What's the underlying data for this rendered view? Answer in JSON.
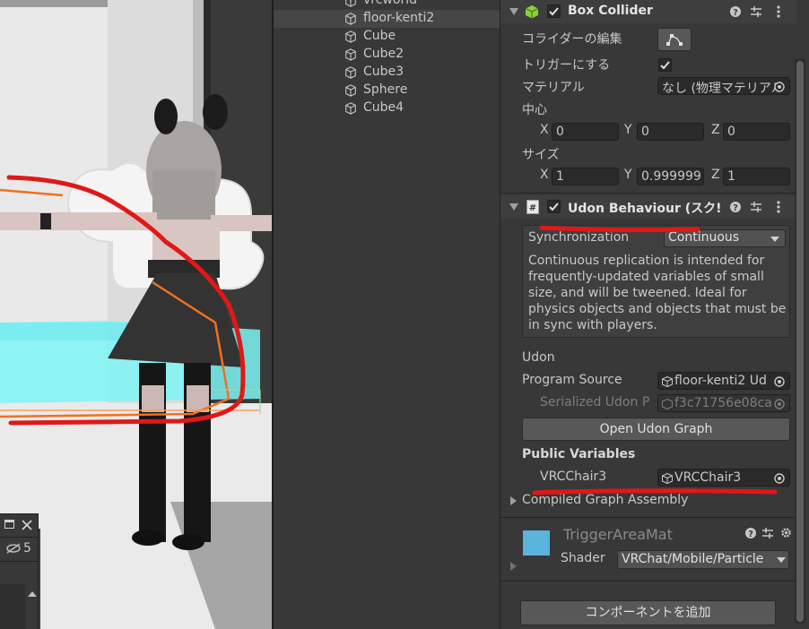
{
  "hierarchy": {
    "items": [
      {
        "label": "vrcworld"
      },
      {
        "label": "floor-kenti2"
      },
      {
        "label": "Cube"
      },
      {
        "label": "Cube2"
      },
      {
        "label": "Cube3"
      },
      {
        "label": "Sphere"
      },
      {
        "label": "Cube4"
      }
    ]
  },
  "scene_panel": {
    "hidden_count": "5"
  },
  "box_collider": {
    "title": "Box Collider",
    "edit_collider_label": "コライダーの編集",
    "is_trigger_label": "トリガーにする",
    "material_label": "マテリアル",
    "material_value": "なし (物理マテリアル",
    "center_label": "中心",
    "center": {
      "x": "0",
      "y": "0",
      "z": "0"
    },
    "size_label": "サイズ",
    "size": {
      "x": "1",
      "y": "0.999999",
      "z": "1"
    },
    "axis_x": "X",
    "axis_y": "Y",
    "axis_z": "Z"
  },
  "udon_behaviour": {
    "title": "Udon Behaviour (スク!",
    "sync_label": "Synchronization",
    "sync_value": "Continuous",
    "sync_description": "Continuous replication is intended for frequently-updated variables of small size, and will be tweened. Ideal for physics objects and objects that must be in sync with players.",
    "udon_section": "Udon",
    "program_source_label": "Program Source",
    "program_source_value": "floor-kenti2 Ud",
    "serialized_label": "Serialized Udon P",
    "serialized_value": "f3c71756e08ca",
    "open_graph_button": "Open Udon Graph",
    "public_variables_label": "Public Variables",
    "var_name": "VRCChair3",
    "var_value": "VRCChair3",
    "compiled_label": "Compiled Graph Assembly"
  },
  "material": {
    "name": "TriggerAreaMat",
    "shader_label": "Shader",
    "shader_value": "VRChat/Mobile/Particle",
    "swatch_color": "#5ab4dc"
  },
  "add_component_button": "コンポーネントを追加",
  "colors": {
    "annotation_red": "#e01818",
    "collider_orange": "#f07020",
    "trigger_cyan": "#7ef4f4"
  }
}
